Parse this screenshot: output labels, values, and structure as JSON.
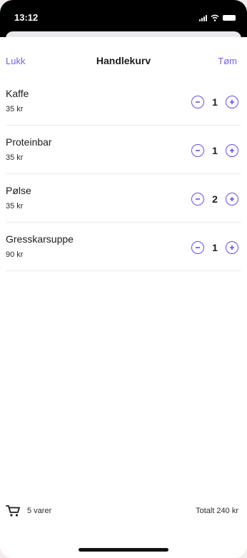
{
  "status_bar": {
    "time": "13:12"
  },
  "nav": {
    "close_label": "Lukk",
    "title": "Handlekurv",
    "clear_label": "Tøm"
  },
  "items": [
    {
      "name": "Kaffe",
      "price": "35 kr",
      "quantity": "1"
    },
    {
      "name": "Proteinbar",
      "price": "35 kr",
      "quantity": "1"
    },
    {
      "name": "Pølse",
      "price": "35 kr",
      "quantity": "2"
    },
    {
      "name": "Gresskarsuppe",
      "price": "90 kr",
      "quantity": "1"
    }
  ],
  "footer": {
    "item_count": "5 varer",
    "total": "Totalt 240 kr"
  },
  "colors": {
    "accent": "#7a5cf0",
    "text": "#1c1c1e"
  },
  "icons": [
    "signal-icon",
    "wifi-icon",
    "battery-icon",
    "minus-circle-icon",
    "plus-circle-icon",
    "cart-icon"
  ]
}
